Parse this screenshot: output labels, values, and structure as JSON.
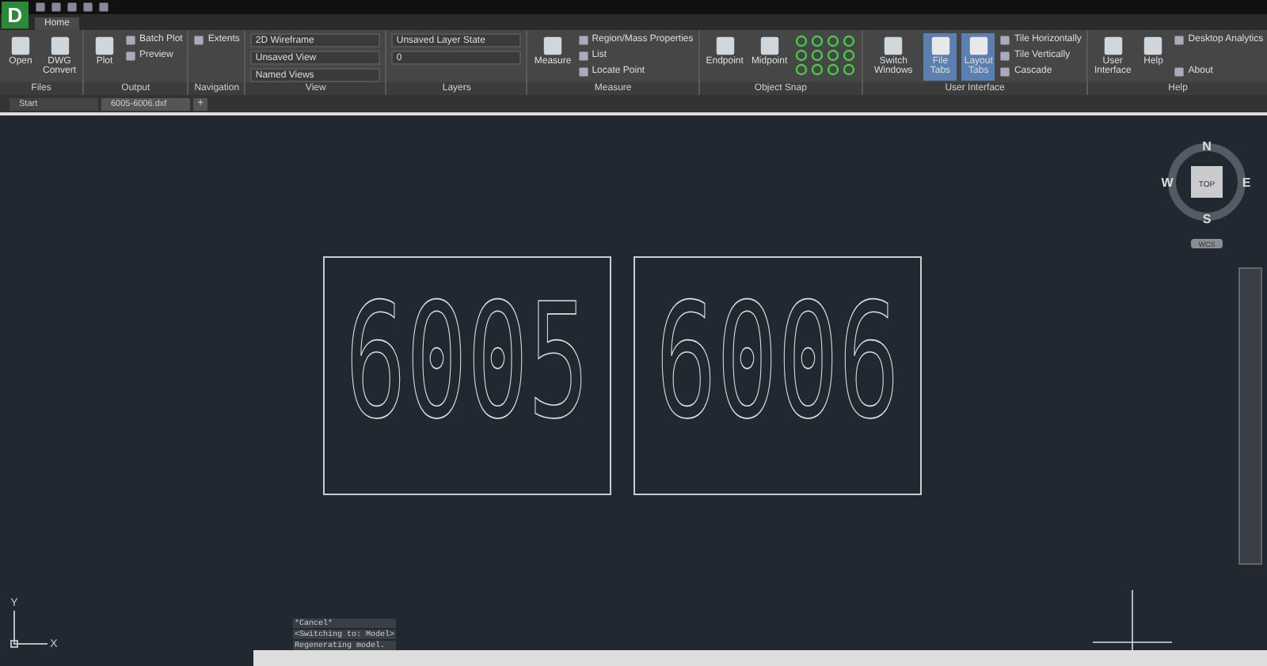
{
  "app": {
    "letter": "D"
  },
  "ribbon_tabs": [
    {
      "label": "Home",
      "selected": true
    }
  ],
  "panels": [
    {
      "title": "Files",
      "columns": [
        {
          "kind": "large",
          "label": "Open"
        },
        {
          "kind": "large",
          "label": "DWG Convert"
        }
      ]
    },
    {
      "title": "Output",
      "columns": [
        {
          "kind": "large",
          "label": "Plot"
        },
        {
          "kind": "stack",
          "items": [
            {
              "label": "Batch Plot"
            },
            {
              "label": "Preview"
            }
          ]
        }
      ]
    },
    {
      "title": "Navigation",
      "columns": [
        {
          "kind": "stack",
          "items": [
            {
              "label": "Extents"
            }
          ]
        }
      ]
    },
    {
      "title": "View",
      "columns": [
        {
          "kind": "dropdowns",
          "items": [
            {
              "label": "2D Wireframe"
            },
            {
              "label": "Unsaved View"
            },
            {
              "label": "Named Views"
            }
          ]
        }
      ]
    },
    {
      "title": "Layers",
      "columns": [
        {
          "kind": "dropdowns",
          "items": [
            {
              "label": "Unsaved Layer State"
            },
            {
              "label": "0"
            }
          ]
        }
      ]
    },
    {
      "title": "Measure",
      "columns": [
        {
          "kind": "large",
          "label": "Measure"
        },
        {
          "kind": "stack",
          "items": [
            {
              "label": "Region/Mass Properties"
            },
            {
              "label": "List"
            },
            {
              "label": "Locate Point"
            }
          ]
        }
      ]
    },
    {
      "title": "Object Snap",
      "columns": [
        {
          "kind": "large",
          "label": "Endpoint"
        },
        {
          "kind": "large",
          "label": "Midpoint"
        },
        {
          "kind": "snaps"
        }
      ]
    },
    {
      "title": "User Interface",
      "columns": [
        {
          "kind": "large",
          "label": "Switch Windows"
        },
        {
          "kind": "toggle",
          "label": "File Tabs",
          "selected": true
        },
        {
          "kind": "toggle",
          "label": "Layout Tabs",
          "selected": true
        },
        {
          "kind": "stack",
          "items": [
            {
              "label": "Tile Horizontally"
            },
            {
              "label": "Tile Vertically"
            },
            {
              "label": "Cascade"
            }
          ]
        }
      ]
    },
    {
      "title": "Help",
      "columns": [
        {
          "kind": "large",
          "label": "User Interface"
        },
        {
          "kind": "large",
          "label": "Help"
        },
        {
          "kind": "stack",
          "spread": true,
          "items": [
            {
              "label": "Desktop Analytics"
            },
            {
              "label": "About"
            }
          ]
        }
      ]
    }
  ],
  "file_tabs": [
    {
      "label": "Start",
      "selected": false
    },
    {
      "label": "6005-6006.dxf",
      "selected": true
    }
  ],
  "new_tab": "+",
  "drawing": {
    "labels": [
      "6005",
      "6006"
    ]
  },
  "viewcube": {
    "north": "N",
    "south": "S",
    "east": "E",
    "west": "W",
    "face": "TOP",
    "ucs": "WCS"
  },
  "ucs_icon": {
    "x": "X",
    "y": "Y"
  },
  "command_history": [
    "*Cancel*",
    "<Switching to: Model>",
    "Regenerating model."
  ]
}
